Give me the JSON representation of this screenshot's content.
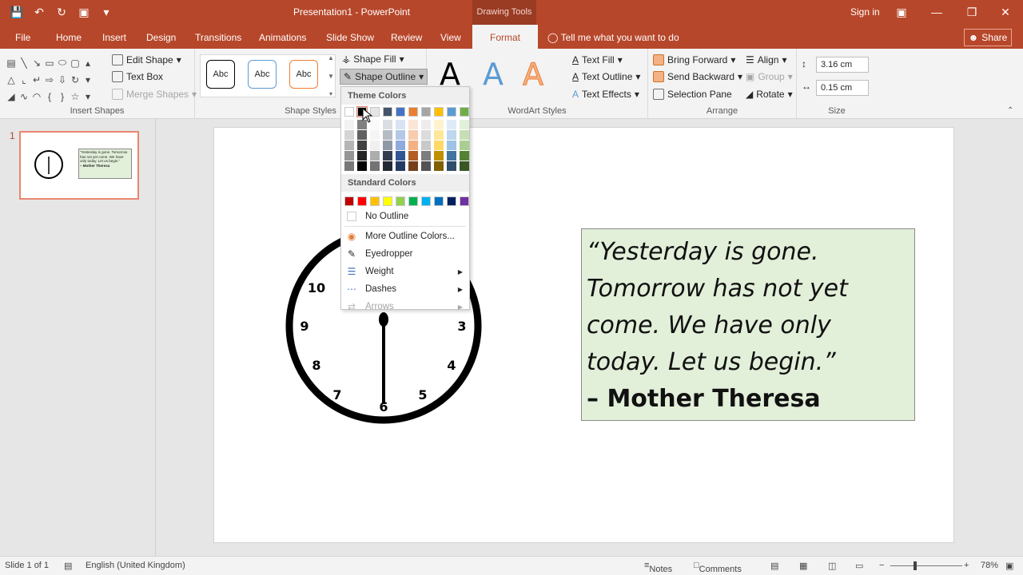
{
  "app": {
    "window_title": "Presentation1 - PowerPoint",
    "context_tab_group": "Drawing Tools",
    "sign_in": "Sign in",
    "share": "Share"
  },
  "tabs": [
    "File",
    "Home",
    "Insert",
    "Design",
    "Transitions",
    "Animations",
    "Slide Show",
    "Review",
    "View",
    "Format"
  ],
  "active_tab": "Format",
  "tell_me": "Tell me what you want to do",
  "ribbon": {
    "insert_shapes": {
      "label": "Insert Shapes",
      "edit_shape": "Edit Shape",
      "text_box": "Text Box",
      "merge_shapes": "Merge Shapes"
    },
    "shape_styles": {
      "label": "Shape Styles",
      "style_sample": "Abc",
      "shape_fill": "Shape Fill",
      "shape_outline": "Shape Outline"
    },
    "wordart_styles": {
      "label": "WordArt Styles",
      "sample": "A",
      "text_fill": "Text Fill",
      "text_outline": "Text Outline",
      "text_effects": "Text Effects"
    },
    "arrange": {
      "label": "Arrange",
      "bring_forward": "Bring Forward",
      "send_backward": "Send Backward",
      "selection_pane": "Selection Pane",
      "align": "Align",
      "group": "Group",
      "rotate": "Rotate"
    },
    "size": {
      "label": "Size",
      "height": "3.16 cm",
      "width": "0.15 cm"
    }
  },
  "dropdown": {
    "theme_colors_label": "Theme Colors",
    "standard_colors_label": "Standard Colors",
    "theme_colors": [
      "#ffffff",
      "#000000",
      "#e7e6e6",
      "#44546a",
      "#4472c4",
      "#ed7d31",
      "#a5a5a5",
      "#ffc000",
      "#5b9bd5",
      "#70ad47"
    ],
    "standard_colors": [
      "#c00000",
      "#ff0000",
      "#ffc000",
      "#ffff00",
      "#92d050",
      "#00b050",
      "#00b0f0",
      "#0070c0",
      "#002060",
      "#7030a0"
    ],
    "no_outline": "No Outline",
    "more_colors": "More Outline Colors...",
    "eyedropper": "Eyedropper",
    "weight": "Weight",
    "dashes": "Dashes",
    "arrows": "Arrows"
  },
  "slide_panel": {
    "slide_number": "1",
    "thumb_quote": "“Yesterday is gone. Tomorrow has not yet come. We have only today. Let us begin.”",
    "thumb_author": "– Mother Theresa"
  },
  "slide": {
    "quote": "“Yesterday is gone. Tomorrow has not yet come. We have only today. Let us begin.”",
    "author": "– Mother Theresa",
    "clock_numbers": [
      "7",
      "8",
      "9",
      "10",
      "3",
      "4",
      "5",
      "6"
    ]
  },
  "status": {
    "slide_info": "Slide 1 of 1",
    "language": "English (United Kingdom)",
    "notes": "Notes",
    "comments": "Comments",
    "zoom": "78%"
  }
}
